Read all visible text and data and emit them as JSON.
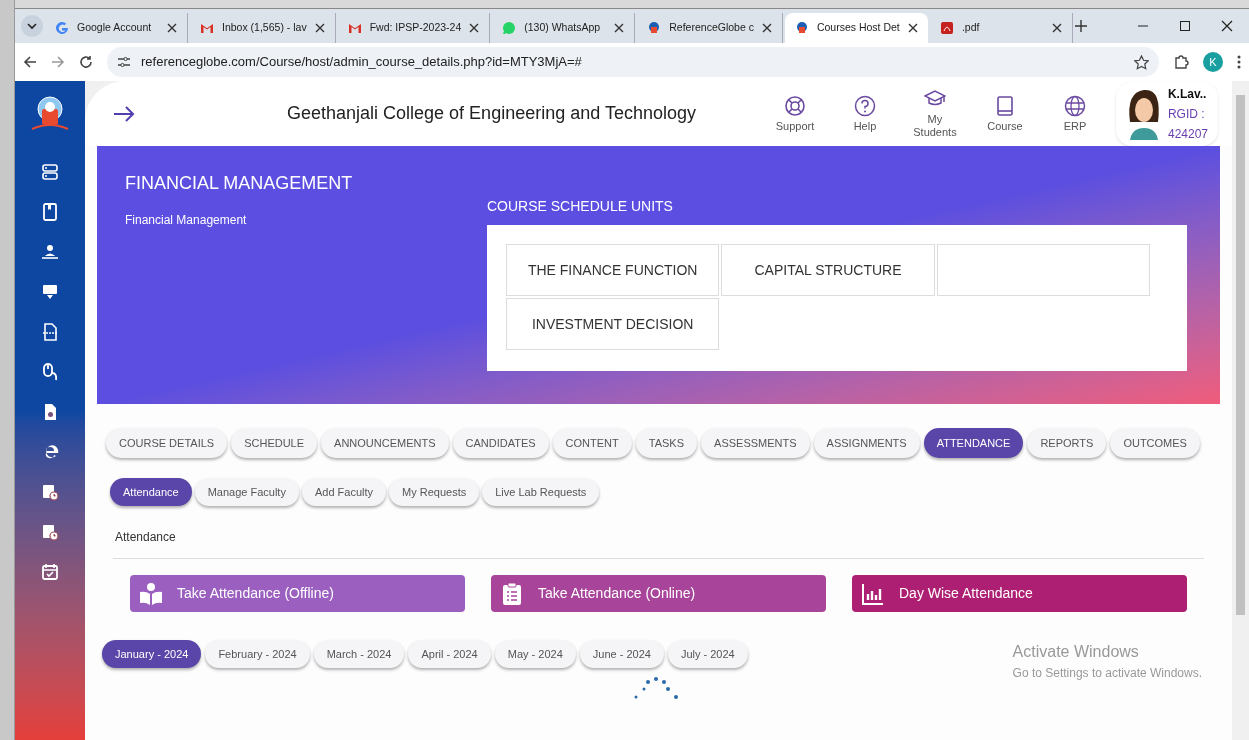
{
  "browser": {
    "tabs": [
      {
        "title": "Google Account",
        "selected": false
      },
      {
        "title": "Inbox (1,565) - lav",
        "selected": false
      },
      {
        "title": "Fwd: IPSP-2023-24",
        "selected": false
      },
      {
        "title": "(130) WhatsApp",
        "selected": false
      },
      {
        "title": "ReferenceGlobe c",
        "selected": false
      },
      {
        "title": "Courses Host Det",
        "selected": true
      },
      {
        "title": ".pdf",
        "selected": false
      }
    ],
    "url": "referenceglobe.com/Course/host/admin_course_details.php?id=MTY3MjA=#",
    "profile_initial": "K"
  },
  "header": {
    "college": "Geethanjali College of Engineering and Technology",
    "nav": [
      {
        "label": "Support"
      },
      {
        "label": "Help"
      },
      {
        "label": "My Students"
      },
      {
        "label": "Course"
      },
      {
        "label": "ERP"
      }
    ],
    "user": {
      "name": "K.Lav..",
      "rgid_label": "RGID :",
      "rgid": "424207"
    }
  },
  "course": {
    "title": "FINANCIAL MANAGEMENT",
    "subtitle": "Financial Management",
    "units_heading": "COURSE SCHEDULE UNITS",
    "units": [
      {
        "kind": "unit",
        "title": "THE FINANCE FUNCTION"
      },
      {
        "kind": "unit",
        "title": "CAPITAL STRUCTURE"
      },
      {
        "kind": "blank"
      },
      {
        "kind": "unit",
        "title": "INVESTMENT DECISION"
      }
    ]
  },
  "main_tabs": [
    {
      "label": "COURSE DETAILS",
      "selected": false
    },
    {
      "label": "SCHEDULE",
      "selected": false
    },
    {
      "label": "ANNOUNCEMENTS",
      "selected": false
    },
    {
      "label": "CANDIDATES",
      "selected": false
    },
    {
      "label": "CONTENT",
      "selected": false
    },
    {
      "label": "TASKS",
      "selected": false
    },
    {
      "label": "ASSESSMENTS",
      "selected": false
    },
    {
      "label": "ASSIGNMENTS",
      "selected": false
    },
    {
      "label": "ATTENDANCE",
      "selected": true
    },
    {
      "label": "REPORTS",
      "selected": false
    },
    {
      "label": "OUTCOMES",
      "selected": false
    }
  ],
  "sub_tabs": [
    {
      "label": "Attendance",
      "selected": true
    },
    {
      "label": "Manage Faculty",
      "selected": false
    },
    {
      "label": "Add Faculty",
      "selected": false
    },
    {
      "label": "My Requests",
      "selected": false
    },
    {
      "label": "Live Lab Requests",
      "selected": false
    }
  ],
  "section_title": "Attendance",
  "actions": [
    {
      "label": "Take Attendance (Offline)",
      "color": "#9b5fc0"
    },
    {
      "label": "Take Attendance (Online)",
      "color": "#a8449a"
    },
    {
      "label": "Day Wise Attendance",
      "color": "#ad1f72"
    }
  ],
  "months": [
    {
      "label": "January - 2024",
      "selected": true
    },
    {
      "label": "February - 2024",
      "selected": false
    },
    {
      "label": "March - 2024",
      "selected": false
    },
    {
      "label": "April - 2024",
      "selected": false
    },
    {
      "label": "May - 2024",
      "selected": false
    },
    {
      "label": "June - 2024",
      "selected": false
    },
    {
      "label": "July - 2024",
      "selected": false
    }
  ],
  "os_notice": {
    "title": "Activate Windows",
    "text": "Go to Settings to activate Windows."
  }
}
